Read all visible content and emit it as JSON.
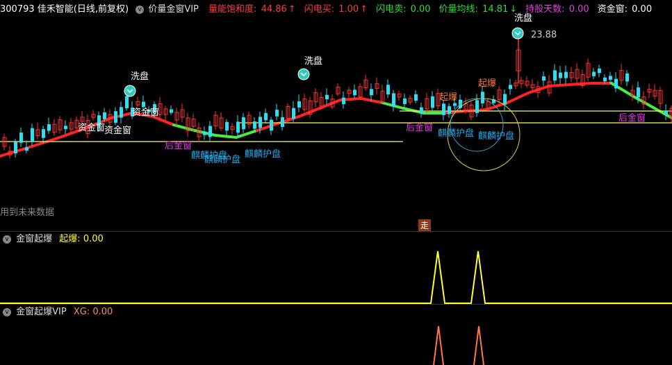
{
  "header": {
    "stock": "300793 佳禾智能(日线,前复权)",
    "indicator": "价量金窗VIP",
    "fields": [
      {
        "label": "量能饱和度: ",
        "value": "44.86",
        "color": "#ff3b3b",
        "arrow": "↑"
      },
      {
        "label": "闪电买: ",
        "value": "1.00",
        "color": "#ff3b3b",
        "arrow": "↑"
      },
      {
        "label": "闪电卖: ",
        "value": "0.00",
        "color": "#33dd33",
        "arrow": ""
      },
      {
        "label": "价量均线: ",
        "value": "14.81",
        "color": "#33dd33",
        "arrow": "↓"
      },
      {
        "label": "持股天数: ",
        "value": "0.00",
        "color": "#dd44dd",
        "arrow": ""
      },
      {
        "label": "资金窗: ",
        "value": "0.00",
        "color": "#ffffff",
        "arrow": ""
      }
    ]
  },
  "annotations": {
    "xipan": "洗盘",
    "xipan_top": "洗盘",
    "high_value": "23.88",
    "zijinchuang": "资金窗",
    "houjinchuang": "后金窗",
    "qibao": "起爆",
    "qilin": "麒麟护盘"
  },
  "future_data_note": "用到未来数据",
  "zou_badge": "走",
  "panel1": {
    "name": "金窗起爆",
    "label": "起爆: ",
    "value": "0.00",
    "color": "#ffff33"
  },
  "panel2": {
    "name": "金窗起爆VIP",
    "label": "XG: ",
    "value": "0.00",
    "color": "#ff8c5a"
  },
  "colors": {
    "up": "#ff3333",
    "down": "#33ddee",
    "ma_up": "#ff2222",
    "ma_down": "#44ee44",
    "line_yellow": "#ffff55",
    "magenta": "#ee33ee",
    "cyan_text": "#22aaee"
  }
}
